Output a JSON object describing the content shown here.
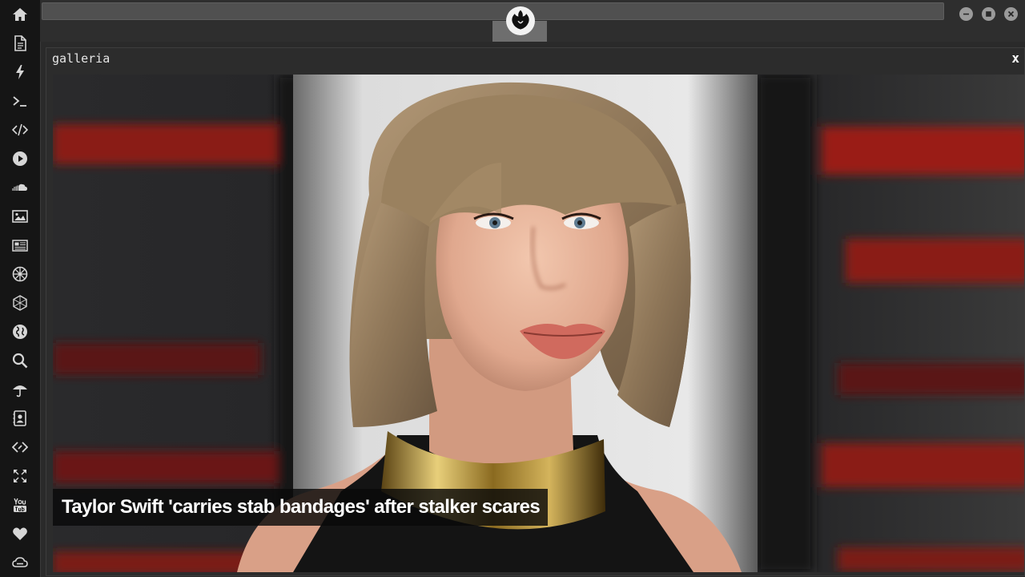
{
  "window": {
    "panel_title": "galleria",
    "close_label": "x"
  },
  "gallery": {
    "caption": "Taylor Swift 'carries stab bandages' after stalker scares"
  },
  "sidebar": {
    "icons": [
      "home-icon",
      "document-icon",
      "bolt-icon",
      "terminal-icon",
      "code-icon",
      "play-icon",
      "soundcloud-icon",
      "image-icon",
      "newspaper-icon",
      "empire-icon",
      "hexagon-icon",
      "globe-icon",
      "search-icon",
      "umbrella-icon",
      "contact-card-icon",
      "code-fork-icon",
      "expand-icon",
      "youtube-icon",
      "heart-icon",
      "cloud-link-icon"
    ]
  },
  "window_controls": [
    "minimize-icon",
    "maximize-icon",
    "close-icon"
  ],
  "logo": "rebel-alliance-icon",
  "colors": {
    "sidebar_bg": "#151515",
    "panel_bg": "#2c2c2c",
    "caption_bg": "#0a0a0a"
  }
}
